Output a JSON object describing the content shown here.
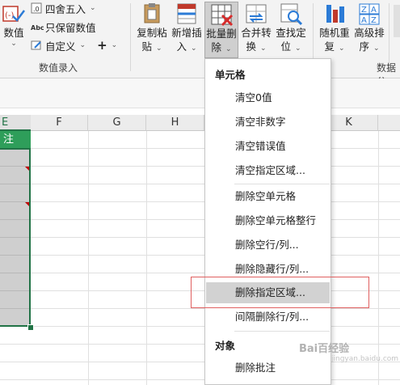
{
  "ribbon": {
    "left_button_label": "数值",
    "small_items": [
      "四舍五入",
      "只保留数值",
      "自定义"
    ],
    "group_label": "数值录入",
    "buttons": [
      {
        "line1": "复制粘",
        "line2": "贴"
      },
      {
        "line1": "新增插",
        "line2": "入"
      },
      {
        "line1": "批量删",
        "line2": "除"
      },
      {
        "line1": "合并转",
        "line2": "换"
      },
      {
        "line1": "查找定",
        "line2": "位"
      },
      {
        "line1": "随机重",
        "line2": "复"
      },
      {
        "line1": "高级排",
        "line2": "序"
      }
    ],
    "right_group_label": "数据分"
  },
  "sheet": {
    "columns": [
      "E",
      "F",
      "G",
      "H",
      "I",
      "J",
      "K"
    ],
    "header_cell": "注"
  },
  "menu": {
    "section1": "单元格",
    "items1": [
      "清空0值",
      "清空非数字",
      "清空错误值",
      "清空指定区域..."
    ],
    "items2": [
      "删除空单元格",
      "删除空单元格整行",
      "删除空行/列...",
      "删除隐藏行/列...",
      "删除指定区域...",
      "间隔删除行/列..."
    ],
    "section2": "对象",
    "items3": [
      "删除批注"
    ]
  },
  "watermark": {
    "text": "Bai百经验",
    "sub": "jingyan.baidu.com"
  },
  "colors": {
    "accent_green": "#217346",
    "header_green": "#2e9e5a",
    "highlight": "#d2d2d2",
    "callout_red": "#e06060"
  }
}
